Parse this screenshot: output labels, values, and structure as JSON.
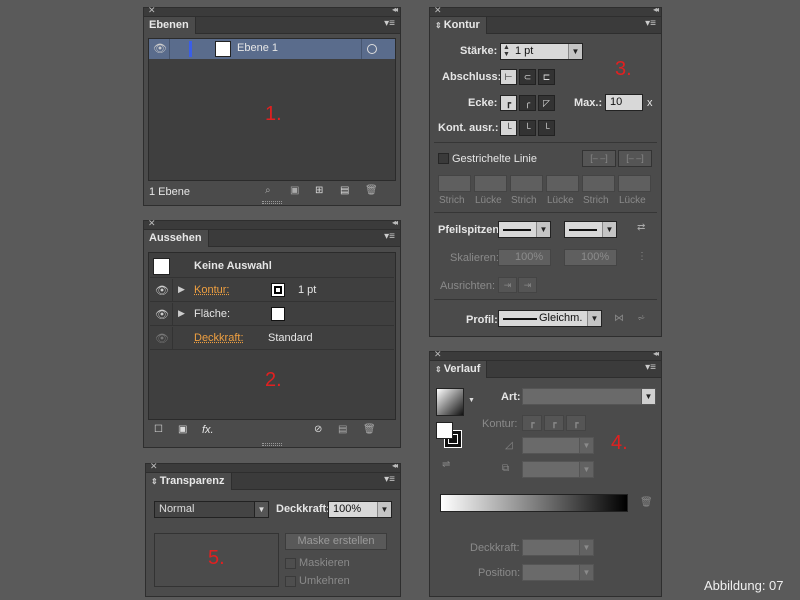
{
  "ebenen": {
    "tab": "Ebenen",
    "layer_name": "Ebene 1",
    "footer_count": "1 Ebene",
    "marker": "1."
  },
  "aussehen": {
    "tab": "Aussehen",
    "header": "Keine Auswahl",
    "rows": [
      {
        "label": "Kontur:",
        "value": "1 pt"
      },
      {
        "label": "Fläche:",
        "value": ""
      },
      {
        "label": "Deckkraft:",
        "value": "Standard"
      }
    ],
    "fx": "fx.",
    "marker": "2."
  },
  "kontur": {
    "tab": "Kontur",
    "staerke_label": "Stärke:",
    "staerke_value": "1 pt",
    "abschluss_label": "Abschluss:",
    "ecke_label": "Ecke:",
    "max_label": "Max.:",
    "max_value": "10",
    "max_unit": "x",
    "kont_label": "Kont. ausr.:",
    "dashed_label": "Gestrichelte Linie",
    "dash_labels": [
      "Strich",
      "Lücke",
      "Strich",
      "Lücke",
      "Strich",
      "Lücke"
    ],
    "pfeil_label": "Pfeilspitzen:",
    "skal_label": "Skalieren:",
    "skal_values": [
      "100%",
      "100%"
    ],
    "ausr_label": "Ausrichten:",
    "profil_label": "Profil:",
    "profil_value": "Gleichm.",
    "marker": "3."
  },
  "verlauf": {
    "tab": "Verlauf",
    "art_label": "Art:",
    "kontur_label": "Kontur:",
    "deckkraft_label": "Deckkraft:",
    "position_label": "Position:",
    "marker": "4."
  },
  "transparenz": {
    "tab": "Transparenz",
    "mode": "Normal",
    "deckkraft_label": "Deckkraft:",
    "deckkraft_value": "100%",
    "maske_button": "Maske erstellen",
    "maskieren": "Maskieren",
    "umkehren": "Umkehren",
    "marker": "5."
  },
  "caption": "Abbildung: 07"
}
